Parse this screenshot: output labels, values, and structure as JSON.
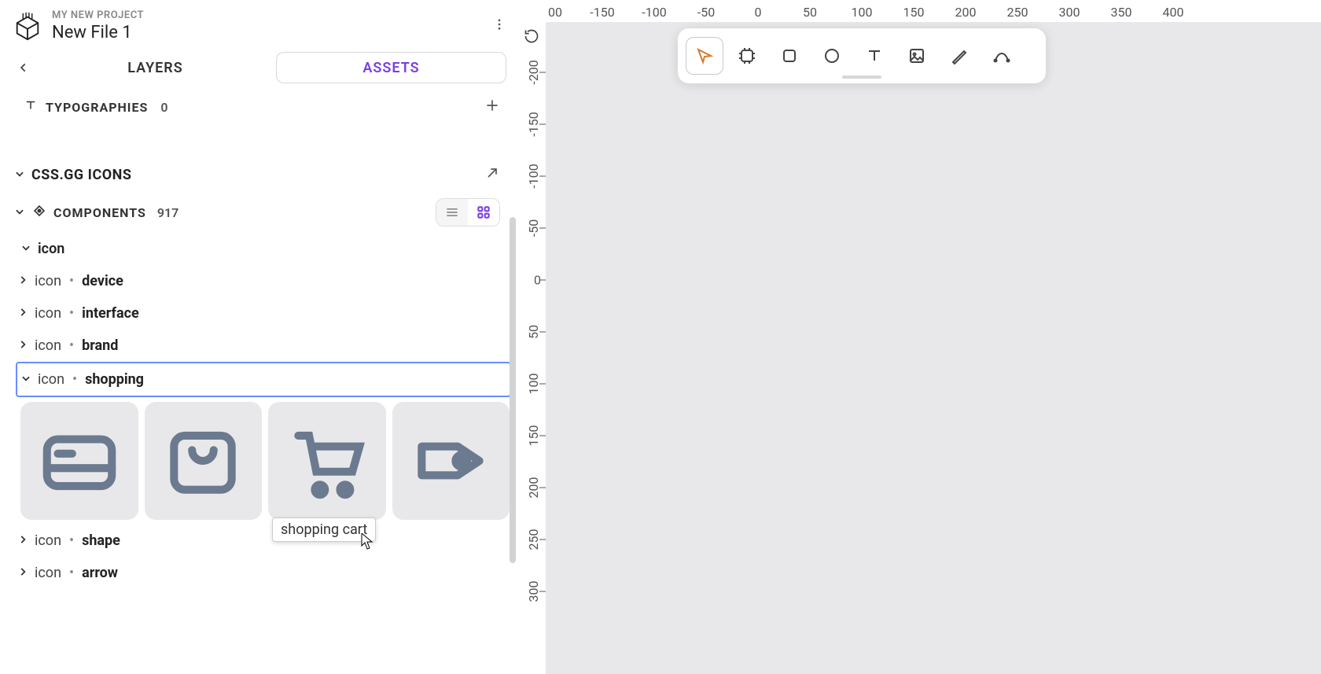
{
  "project": {
    "name": "MY NEW PROJECT",
    "file": "New File 1"
  },
  "tabs": {
    "layers": "LAYERS",
    "assets": "ASSETS"
  },
  "typographies": {
    "label": "TYPOGRAPHIES",
    "count": "0"
  },
  "library": {
    "name": "CSS.GG ICONS"
  },
  "components": {
    "label": "COMPONENTS",
    "count": "917"
  },
  "categories": {
    "root": "icon",
    "items": [
      {
        "prefix": "icon",
        "name": "device",
        "expanded": false,
        "selected": false
      },
      {
        "prefix": "icon",
        "name": "interface",
        "expanded": false,
        "selected": false
      },
      {
        "prefix": "icon",
        "name": "brand",
        "expanded": false,
        "selected": false
      },
      {
        "prefix": "icon",
        "name": "shopping",
        "expanded": true,
        "selected": true
      },
      {
        "prefix": "icon",
        "name": "shape",
        "expanded": false,
        "selected": false
      },
      {
        "prefix": "icon",
        "name": "arrow",
        "expanded": false,
        "selected": false
      }
    ]
  },
  "thumbnails": [
    {
      "icon": "credit-card"
    },
    {
      "icon": "shopping-bag"
    },
    {
      "icon": "shopping-cart"
    },
    {
      "icon": "price-tag"
    }
  ],
  "tooltip": "shopping cart",
  "top_ruler": [
    "00",
    "-150",
    "-100",
    "-50",
    "0",
    "50",
    "100",
    "150",
    "200",
    "250",
    "300",
    "350",
    "400"
  ],
  "left_ruler": [
    "-200",
    "-150",
    "-100",
    "-50",
    "0",
    "50",
    "100",
    "150",
    "200",
    "250",
    "300"
  ],
  "tools": [
    {
      "id": "move",
      "active": true
    },
    {
      "id": "frame",
      "active": false
    },
    {
      "id": "rect",
      "active": false
    },
    {
      "id": "ellipse",
      "active": false
    },
    {
      "id": "text",
      "active": false
    },
    {
      "id": "image",
      "active": false
    },
    {
      "id": "pen",
      "active": false
    },
    {
      "id": "curve",
      "active": false
    }
  ]
}
